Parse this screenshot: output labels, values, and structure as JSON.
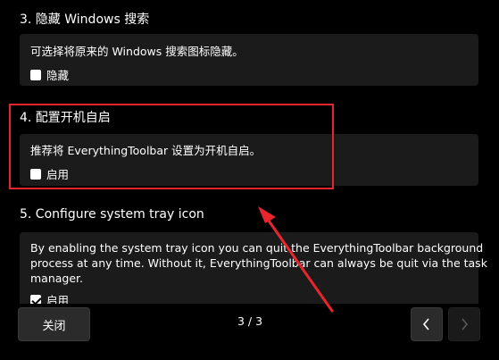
{
  "sections": [
    {
      "heading": "3. 隐藏 Windows 搜索",
      "description": "可选择将原来的 Windows 搜索图标隐藏。",
      "checkbox_label": "隐藏",
      "checked": false
    },
    {
      "heading": "4. 配置开机自启",
      "description": "推荐将 EverythingToolbar 设置为开机自启。",
      "checkbox_label": "启用",
      "checked": false
    },
    {
      "heading": "5. Configure system tray icon",
      "description_lines": [
        "By enabling the system tray icon you can quit the EverythingToolbar background",
        "process at any time. Without it, EverythingToolbar can always be quit via the task",
        "manager."
      ],
      "checkbox_label": "启用",
      "checked": true
    }
  ],
  "footer": {
    "close_label": "关闭",
    "page_indicator": "3 / 3",
    "prev_icon": "chevron-left-icon",
    "next_icon": "chevron-right-icon"
  },
  "annotation": {
    "highlight_color": "#e5262d",
    "arrow_color": "#e5262d"
  }
}
